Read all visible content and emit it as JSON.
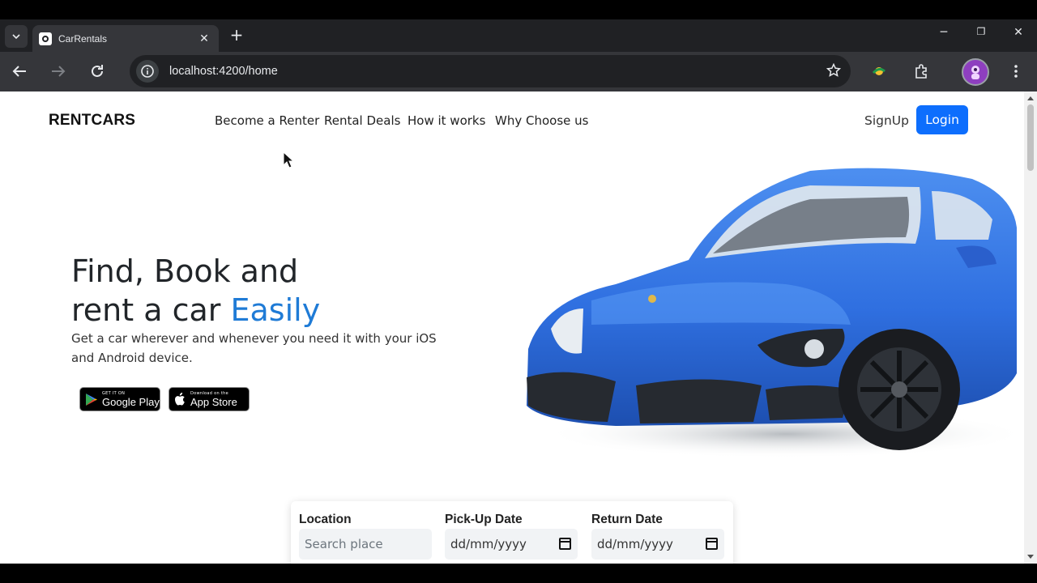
{
  "browser": {
    "tab_title": "CarRentals",
    "url": "localhost:4200/home",
    "new_tab": "+",
    "close_tab": "✕",
    "window_controls": [
      "─",
      "❐",
      "✕"
    ]
  },
  "site": {
    "brand": "RENTCARS",
    "nav": [
      "Become a Renter",
      "Rental Deals",
      "How it works",
      "Why Choose us"
    ],
    "signup": "SignUp",
    "login": "Login"
  },
  "hero": {
    "title_line1": "Find, Book and",
    "title_line2_prefix": "rent a car ",
    "title_accent": "Easily",
    "subtitle": "Get a car wherever and whenever you need it with your iOS and Android device.",
    "google_play_small": "GET IT ON",
    "google_play_big": "Google Play",
    "app_store_small": "Download on the",
    "app_store_big": "App Store"
  },
  "search": {
    "location_label": "Location",
    "location_placeholder": "Search place",
    "pickup_label": "Pick-Up Date",
    "pickup_value": "dd/mm/yyyy",
    "return_label": "Return Date",
    "return_value": "dd/mm/yyyy"
  },
  "colors": {
    "accent": "#1f7bd6",
    "primary_button": "#0d6efd",
    "car_body": "#2f6fe0"
  }
}
